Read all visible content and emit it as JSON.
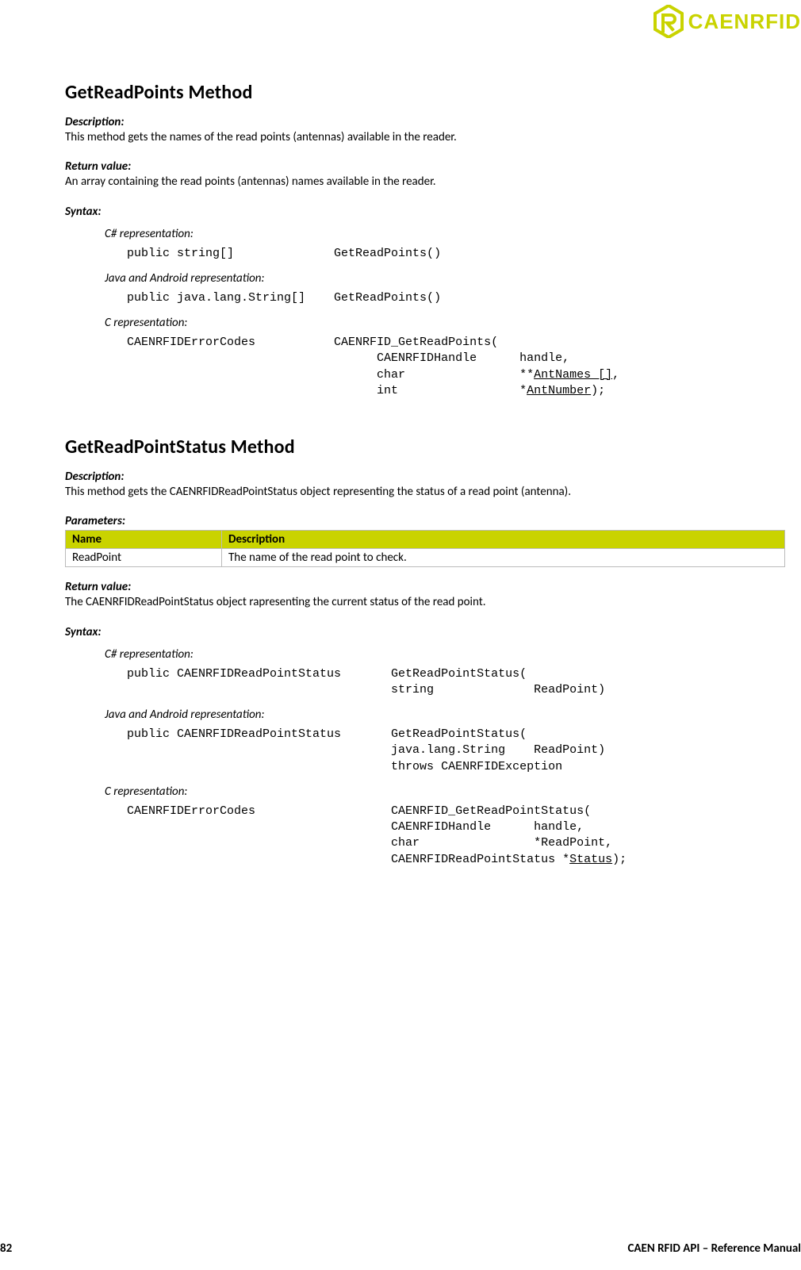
{
  "header": {
    "brand_text": "CAENRFID"
  },
  "sec1": {
    "title": "GetReadPoints Method",
    "desc_label": "Description:",
    "desc_text": "This method gets the names of the read points (antennas) available in the reader.",
    "retval_label": "Return value:",
    "retval_text": "An array containing the read points (antennas) names available in the reader.",
    "syntax_label": "Syntax:",
    "csharp_label": "C# representation:",
    "csharp_code": "public string[]              GetReadPoints()",
    "java_label": "Java and Android representation:",
    "java_code": "public java.lang.String[]    GetReadPoints()",
    "c_label": "C representation:",
    "c_code_line1": "CAENRFIDErrorCodes           CAENRFID_GetReadPoints(",
    "c_code_line2": "                                   CAENRFIDHandle      handle,",
    "c_code_line3_prefix": "                                   char                **",
    "c_code_line3_u": "AntNames []",
    "c_code_line3_suffix": ",",
    "c_code_line4_prefix": "                                   int                 *",
    "c_code_line4_u": "AntNumber",
    "c_code_line4_suffix": ");"
  },
  "sec2": {
    "title": "GetReadPointStatus Method",
    "desc_label": "Description:",
    "desc_text": "This method gets the CAENRFIDReadPointStatus object representing the status of a read point (antenna).",
    "params_label": "Parameters:",
    "table": {
      "h1": "Name",
      "h2": "Description",
      "r1c1": "ReadPoint",
      "r1c2": "The name of the read point to check."
    },
    "retval_label": "Return value:",
    "retval_text": "The CAENRFIDReadPointStatus object rapresenting the current status of the read point.",
    "syntax_label": "Syntax:",
    "csharp_label": "C# representation:",
    "csharp_code": "public CAENRFIDReadPointStatus       GetReadPointStatus(\n                                     string              ReadPoint)",
    "java_label": "Java and Android representation:",
    "java_code": "public CAENRFIDReadPointStatus       GetReadPointStatus(\n                                     java.lang.String    ReadPoint)\n                                     throws CAENRFIDException",
    "c_label": "C representation:",
    "c_code_line1": "CAENRFIDErrorCodes                   CAENRFID_GetReadPointStatus(",
    "c_code_line2": "                                     CAENRFIDHandle      handle,",
    "c_code_line3": "                                     char                *ReadPoint,",
    "c_code_line4_prefix": "                                     CAENRFIDReadPointStatus *",
    "c_code_line4_u": "Status",
    "c_code_line4_suffix": ");"
  },
  "footer": {
    "page_num": "82",
    "manual": "CAEN RFID API – Reference Manual"
  }
}
